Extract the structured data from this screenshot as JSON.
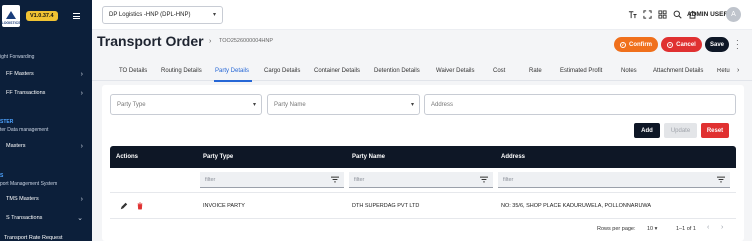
{
  "sidebar": {
    "version": "V1.0.37.4",
    "logo_text": "LOGISTICS",
    "sections": [
      {
        "label": "ight Forwarding"
      },
      {
        "label": "ter Data management"
      },
      {
        "label": "port Management System"
      }
    ],
    "headings": [
      {
        "label": "STER"
      },
      {
        "label": "S"
      }
    ],
    "items": [
      {
        "label": "FF Masters"
      },
      {
        "label": "FF Transactions"
      },
      {
        "label": "Masters"
      },
      {
        "label": "TMS Masters"
      },
      {
        "label": "S Transactions"
      },
      {
        "label": "Transport Rate Request"
      }
    ]
  },
  "topbar": {
    "company_value": "DP Logistics -HNP  (DPL-HNP)",
    "icons": [
      "text-size-icon",
      "expand-icon",
      "grid-icon",
      "search-icon",
      "home-icon"
    ],
    "user_name": "ADMIN USER",
    "avatar_letter": "A"
  },
  "header": {
    "title": "Transport Order",
    "order_number": "TOO2526000004HNP",
    "confirm_label": "Confirm",
    "cancel_label": "Cancel",
    "save_label": "Save"
  },
  "tabs": [
    {
      "label": "TO Details"
    },
    {
      "label": "Routing Details"
    },
    {
      "label": "Party Details"
    },
    {
      "label": "Cargo Details"
    },
    {
      "label": "Container Details"
    },
    {
      "label": "Detention Details"
    },
    {
      "label": "Waiver Details"
    },
    {
      "label": "Cost"
    },
    {
      "label": "Rate"
    },
    {
      "label": "Estimated Profit"
    },
    {
      "label": "Notes"
    },
    {
      "label": "Attachment Details"
    },
    {
      "label": "Retu"
    }
  ],
  "active_tab": "Party Details",
  "form": {
    "party_type_placeholder": "Party Type",
    "party_name_placeholder": "Party Name",
    "address_placeholder": "Address",
    "add_label": "Add",
    "update_label": "Update",
    "reset_label": "Reset"
  },
  "table": {
    "columns": [
      "Actions",
      "Party Type",
      "Party Name",
      "Address"
    ],
    "filter_placeholder": "filter",
    "rows": [
      {
        "party_type": "INVOICE PARTY",
        "party_name": "DTH SUPERDAG PVT LTD",
        "address": "NO: 35/6, SHOP PLACE KADURUWELA, POLLONNARUWA"
      }
    ]
  },
  "pagination": {
    "rows_per_page_label": "Rows per page:",
    "rows_per_page_value": "10",
    "range": "1–1 of 1"
  },
  "colors": {
    "sidebar_bg": "#0c1f3a",
    "accent": "#2667d6",
    "confirm": "#f0701c",
    "danger": "#e03131",
    "dark": "#0e1726"
  }
}
